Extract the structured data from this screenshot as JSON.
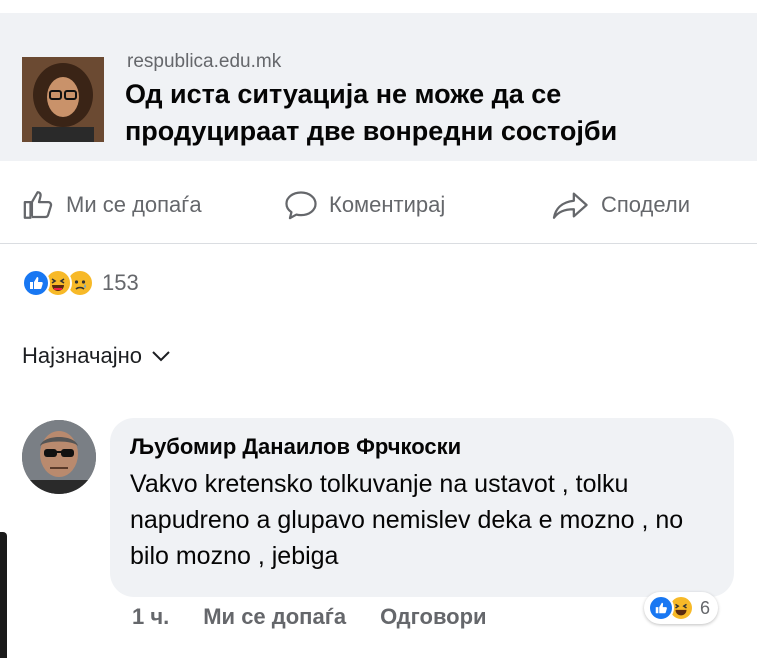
{
  "link_preview": {
    "domain": "respublica.edu.mk",
    "title": "Од иста ситуација не може да се продуцираат две вонредни состојби"
  },
  "actions": {
    "like_label": "Ми се допаѓа",
    "comment_label": "Коментирај",
    "share_label": "Сподели"
  },
  "reactions": {
    "icons": [
      "like-icon",
      "haha-icon",
      "sad-icon"
    ],
    "count": "153"
  },
  "sort": {
    "label": "Најзначајно"
  },
  "comment": {
    "author": "Љубомир Данаилов Фрчкоски",
    "text": "Vakvo kretensko tolkuvanje na ustavot , tolku napudreno a glupavo nemislev deka e mozno , no bilo mozno , jebiga",
    "time": "1 ч.",
    "like_label": "Ми се допаѓа",
    "reply_label": "Одговори",
    "reactions": {
      "icons": [
        "like-icon",
        "haha-icon"
      ],
      "count": "6"
    }
  },
  "colors": {
    "like_blue": "#1877f2",
    "reaction_yellow": "#f7b928",
    "secondary_text": "#65676b",
    "card_bg": "#f0f2f5"
  }
}
